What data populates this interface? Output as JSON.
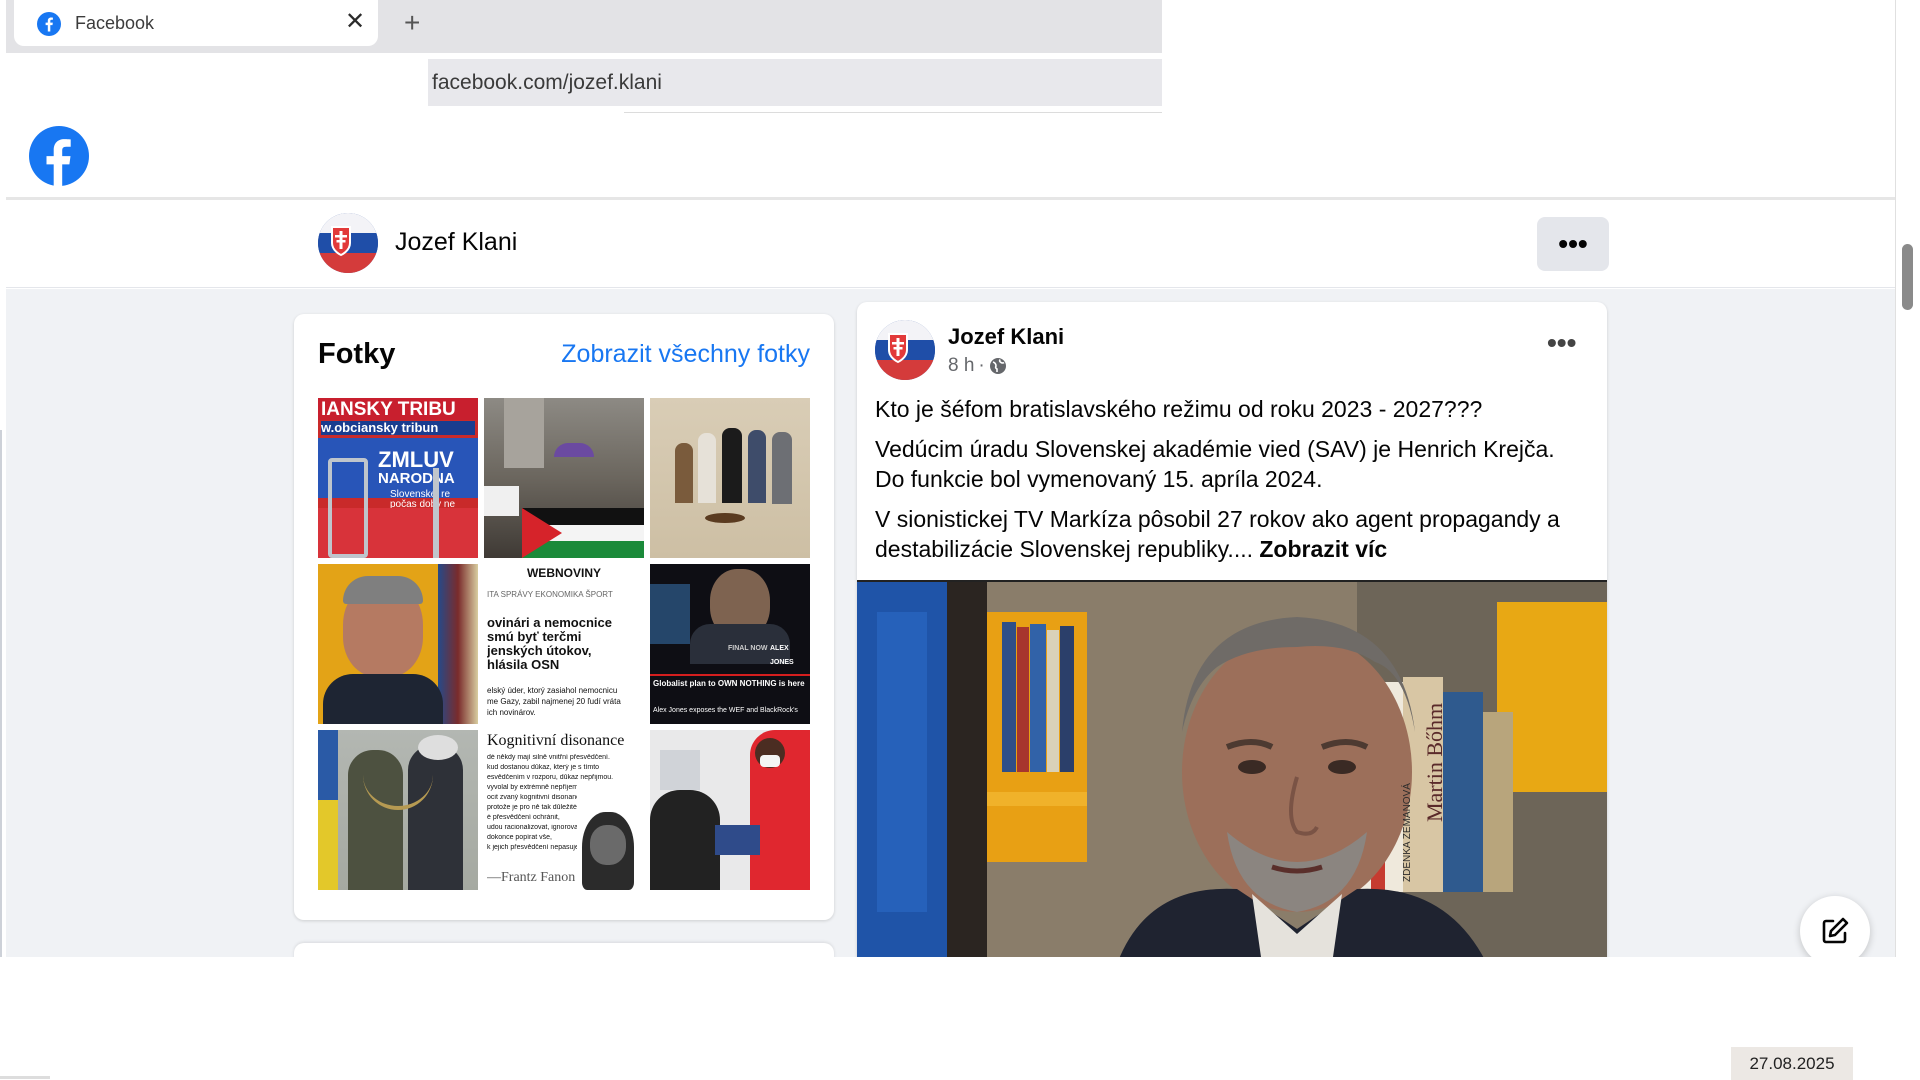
{
  "browser": {
    "tab_title": "Facebook",
    "close_glyph": "✕",
    "new_tab_glyph": "+",
    "url": "facebook.com/jozef.klani"
  },
  "profile": {
    "name": "Jozef Klani",
    "more_glyph": "•••"
  },
  "photos": {
    "title": "Fotky",
    "see_all": "Zobrazit všechny fotky",
    "items": [
      {
        "caption_1": "IANSKY TRIBU",
        "caption_2": "w.obciansky tribun",
        "caption_3": "ZMLUV",
        "caption_4": "NÁRODNÁ",
        "caption_5": "Slovenskej re",
        "caption_6": "počas doby ne"
      },
      {
        "caption_1": ""
      },
      {
        "caption_1": ""
      },
      {
        "caption_1": ""
      },
      {
        "caption_1": "WEBNOVINY",
        "caption_2": "ITA   SPRÁVY   EKONOMIKA   ŠPORT",
        "caption_3": "ovinári a nemocnice",
        "caption_4": "smú byť terčmi",
        "caption_5": "jenských útokov,",
        "caption_6": "hlásila OSN",
        "caption_7": "elský úder, ktorý zasiahol nemocnicu",
        "caption_8": "me Gazy, zabil najmenej 20 ľudí vráta",
        "caption_9": "ich novinárov."
      },
      {
        "caption_1": "FINAL NOW",
        "caption_2": "ALEX JONES",
        "caption_3": "Globalist plan to OWN NOTHING is here",
        "caption_4": "Alex Jones exposes the WEF and BlackRock's"
      },
      {
        "caption_1": ""
      },
      {
        "caption_1": "Kognitivní disonance",
        "caption_2": "dé někdy mají silně vnitřní přesvědčení.",
        "caption_3": "kud dostanou důkaz, který je s tímto",
        "caption_4": "esvědčením v rozporu, důkaz nepřijmou.",
        "caption_5": "vyvolal by extrémně nepříjemný",
        "caption_6": "ocit zvaný kognitivní disonance.",
        "caption_7": "protože je pro ně tak důležité",
        "caption_8": "é přesvědčení ochránit,",
        "caption_9": "udou racionalizovat, ignorovat",
        "caption_10": "dokonce popírat vše,",
        "caption_11": "k jejich přesvědčení nepasuje.",
        "caption_12": "—Frantz Fanon"
      },
      {
        "caption_1": ""
      }
    ]
  },
  "post": {
    "author": "Jozef Klani",
    "time": "8 h",
    "separator": "·",
    "more_glyph": "•••",
    "paragraph_1": "Kto je šéfom bratislavského režimu od roku 2023 - 2027???",
    "paragraph_2": "Vedúcim úradu Slovenskej akadémie vied (SAV) je Henrich Krejča. Do funkcie bol vymenovaný 15. apríla 2024.",
    "paragraph_3": "V sionistickej TV Markíza pôsobil 27 rokov ako agent propagandy a destabilizácie Slovenskej republiky.... ",
    "see_more": "Zobrazit víc",
    "image_book_1": "Martin Bőhm",
    "image_book_2": "ZDENKA ZEMANOVÁ"
  },
  "footer": {
    "date": "27.08.2025"
  },
  "colors": {
    "fb_blue": "#1877f2",
    "page_bg": "#f0f2f5",
    "card_bg": "#ffffff",
    "secondary_text": "#65676b"
  },
  "icons": [
    "facebook-logo-icon",
    "close-icon",
    "plus-icon",
    "more-icon",
    "globe-icon",
    "compose-icon"
  ]
}
